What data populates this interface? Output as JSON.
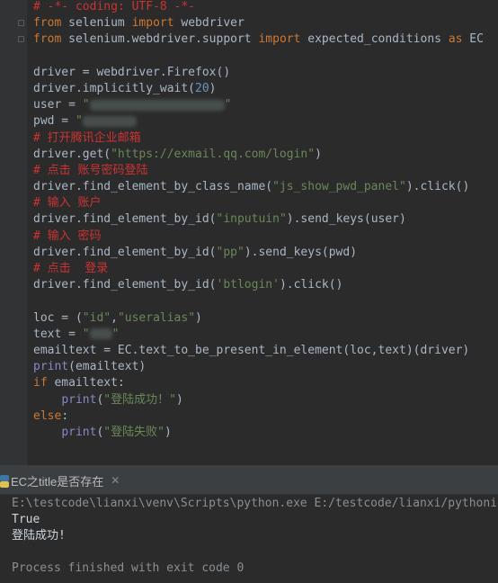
{
  "editor": {
    "lines": [
      [
        {
          "t": "# -*- coding: UTF-8 -*-",
          "c": "cm"
        }
      ],
      [
        {
          "t": "from",
          "c": "kw"
        },
        {
          "t": " selenium "
        },
        {
          "t": "import",
          "c": "kw"
        },
        {
          "t": " webdriver"
        }
      ],
      [
        {
          "t": "from",
          "c": "kw"
        },
        {
          "t": " selenium.webdriver.support "
        },
        {
          "t": "import",
          "c": "kw"
        },
        {
          "t": " expected_conditions "
        },
        {
          "t": "as",
          "c": "kw"
        },
        {
          "t": " EC"
        }
      ],
      [],
      [
        {
          "t": "driver = webdriver.Firefox()"
        }
      ],
      [
        {
          "t": "driver.implicitly_wait("
        },
        {
          "t": "20",
          "c": "num"
        },
        {
          "t": ")"
        }
      ],
      [
        {
          "t": "user = "
        },
        {
          "t": "\"",
          "c": "st"
        },
        {
          "blur": 150
        },
        {
          "t": "\"",
          "c": "st"
        }
      ],
      [
        {
          "t": "pwd = "
        },
        {
          "t": "\"",
          "c": "st"
        },
        {
          "blur": 60
        }
      ],
      [
        {
          "t": "# 打开腾讯企业邮箱",
          "c": "cm"
        }
      ],
      [
        {
          "t": "driver.get("
        },
        {
          "t": "\"https://exmail.qq.com/login\"",
          "c": "st"
        },
        {
          "t": ")"
        }
      ],
      [
        {
          "t": "# 点击 账号密码登陆",
          "c": "cm"
        }
      ],
      [
        {
          "t": "driver.find_element_by_class_name("
        },
        {
          "t": "\"js_show_pwd_panel\"",
          "c": "st"
        },
        {
          "t": ").click()"
        }
      ],
      [
        {
          "t": "# 输入 账户",
          "c": "cm"
        }
      ],
      [
        {
          "t": "driver.find_element_by_id("
        },
        {
          "t": "\"inputuin\"",
          "c": "st"
        },
        {
          "t": ").send_keys(user)"
        }
      ],
      [
        {
          "t": "# 输入 密码",
          "c": "cm"
        }
      ],
      [
        {
          "t": "driver.find_element_by_id("
        },
        {
          "t": "\"pp\"",
          "c": "st"
        },
        {
          "t": ").send_keys(pwd)"
        }
      ],
      [
        {
          "t": "# 点击  登录",
          "c": "cm"
        }
      ],
      [
        {
          "t": "driver.find_element_by_id("
        },
        {
          "t": "'btlogin'",
          "c": "st"
        },
        {
          "t": ").click()"
        }
      ],
      [],
      [
        {
          "t": "loc = ("
        },
        {
          "t": "\"id\"",
          "c": "st"
        },
        {
          "t": ","
        },
        {
          "t": "\"useralias\"",
          "c": "st"
        },
        {
          "t": ")"
        }
      ],
      [
        {
          "t": "text = "
        },
        {
          "t": "\"",
          "c": "st"
        },
        {
          "blur": 25
        },
        {
          "t": "\"",
          "c": "st"
        }
      ],
      [
        {
          "t": "emailtext = EC.text_to_be_present_in_element(loc,text)(driver)"
        }
      ],
      [
        {
          "t": "print",
          "c": "bi"
        },
        {
          "t": "(emailtext)"
        }
      ],
      [
        {
          "t": "if",
          "c": "kw"
        },
        {
          "t": " emailtext:"
        }
      ],
      [
        {
          "t": "    "
        },
        {
          "t": "print",
          "c": "bi"
        },
        {
          "t": "("
        },
        {
          "t": "\"登陆成功！\"",
          "c": "st"
        },
        {
          "t": ")"
        }
      ],
      [
        {
          "t": "else",
          "c": "kw"
        },
        {
          "t": ":"
        }
      ],
      [
        {
          "t": "    "
        },
        {
          "t": "print",
          "c": "bi"
        },
        {
          "t": "("
        },
        {
          "t": "\"登陆失败\"",
          "c": "st"
        },
        {
          "t": ")"
        }
      ]
    ]
  },
  "run_panel": {
    "tab_label": "EC之title是否存在",
    "close_symbol": "✕",
    "console": [
      {
        "text": "E:\\testcode\\lianxi\\venv\\Scripts\\python.exe E:/testcode/lianxi/pythonio/",
        "kind": "path"
      },
      {
        "text": "True",
        "kind": "out"
      },
      {
        "text": "登陆成功!",
        "kind": "out"
      },
      {
        "text": "",
        "kind": "out"
      },
      {
        "text": "Process finished with exit code 0",
        "kind": "proc"
      }
    ]
  },
  "colors": {
    "background": "#2b2b2b",
    "keyword": "#cc7832",
    "comment": "#cc3333",
    "string": "#6a8759",
    "number": "#6897bb",
    "builtin": "#8888c6",
    "default_text": "#a9b7c6"
  },
  "icons": {
    "run_tab": "python-icon",
    "close": "close-icon",
    "gutter": "fold-marker-icon"
  }
}
